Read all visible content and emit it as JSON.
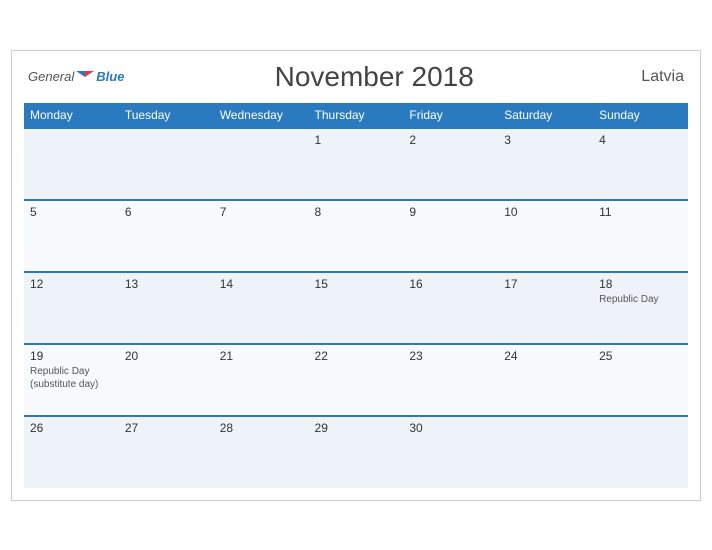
{
  "header": {
    "logo": {
      "general": "General",
      "blue": "Blue",
      "flag_title": "GeneralBlue Logo"
    },
    "title": "November 2018",
    "country": "Latvia"
  },
  "weekdays": [
    "Monday",
    "Tuesday",
    "Wednesday",
    "Thursday",
    "Friday",
    "Saturday",
    "Sunday"
  ],
  "weeks": [
    [
      {
        "day": "",
        "holiday": ""
      },
      {
        "day": "",
        "holiday": ""
      },
      {
        "day": "",
        "holiday": ""
      },
      {
        "day": "1",
        "holiday": ""
      },
      {
        "day": "2",
        "holiday": ""
      },
      {
        "day": "3",
        "holiday": ""
      },
      {
        "day": "4",
        "holiday": ""
      }
    ],
    [
      {
        "day": "5",
        "holiday": ""
      },
      {
        "day": "6",
        "holiday": ""
      },
      {
        "day": "7",
        "holiday": ""
      },
      {
        "day": "8",
        "holiday": ""
      },
      {
        "day": "9",
        "holiday": ""
      },
      {
        "day": "10",
        "holiday": ""
      },
      {
        "day": "11",
        "holiday": ""
      }
    ],
    [
      {
        "day": "12",
        "holiday": ""
      },
      {
        "day": "13",
        "holiday": ""
      },
      {
        "day": "14",
        "holiday": ""
      },
      {
        "day": "15",
        "holiday": ""
      },
      {
        "day": "16",
        "holiday": ""
      },
      {
        "day": "17",
        "holiday": ""
      },
      {
        "day": "18",
        "holiday": "Republic Day"
      }
    ],
    [
      {
        "day": "19",
        "holiday": "Republic Day (substitute day)"
      },
      {
        "day": "20",
        "holiday": ""
      },
      {
        "day": "21",
        "holiday": ""
      },
      {
        "day": "22",
        "holiday": ""
      },
      {
        "day": "23",
        "holiday": ""
      },
      {
        "day": "24",
        "holiday": ""
      },
      {
        "day": "25",
        "holiday": ""
      }
    ],
    [
      {
        "day": "26",
        "holiday": ""
      },
      {
        "day": "27",
        "holiday": ""
      },
      {
        "day": "28",
        "holiday": ""
      },
      {
        "day": "29",
        "holiday": ""
      },
      {
        "day": "30",
        "holiday": ""
      },
      {
        "day": "",
        "holiday": ""
      },
      {
        "day": "",
        "holiday": ""
      }
    ]
  ]
}
